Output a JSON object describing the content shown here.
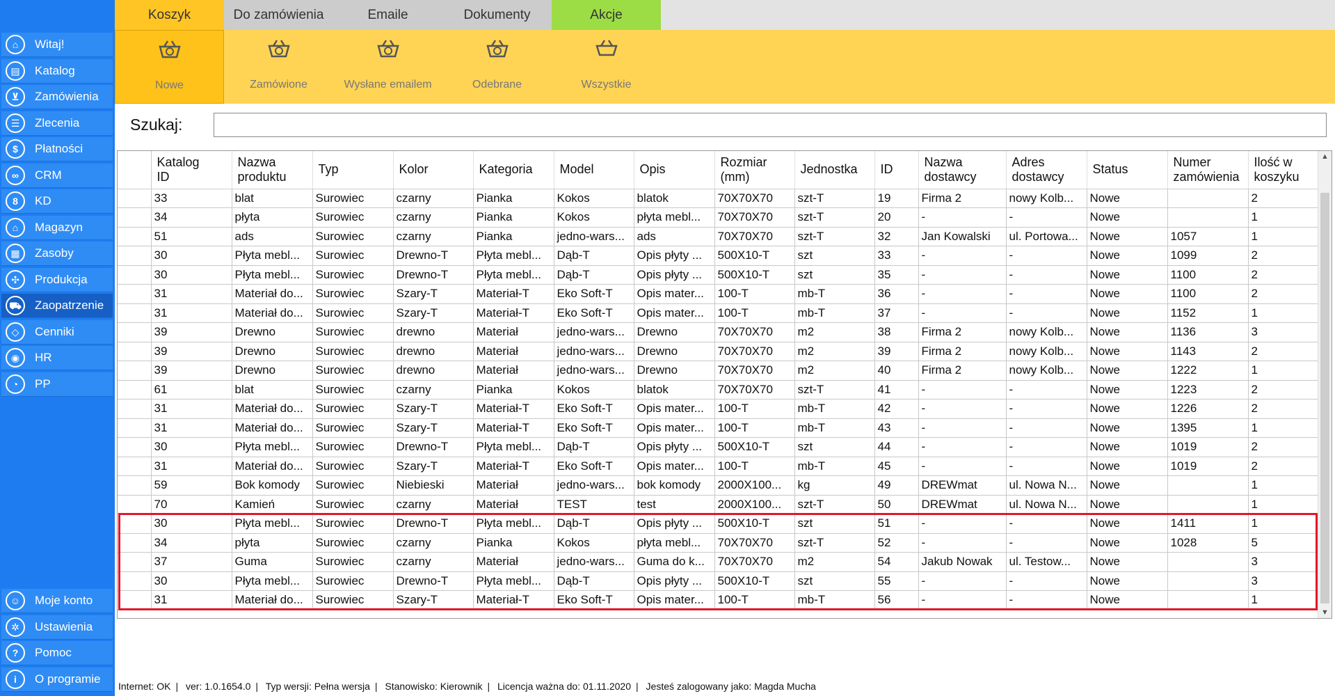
{
  "sidebar": {
    "top_items": [
      {
        "label": "Witaj!",
        "icon": "home-icon",
        "glyph": "⌂"
      },
      {
        "label": "Katalog",
        "icon": "catalog-icon",
        "glyph": "▤"
      },
      {
        "label": "Zamówienia",
        "icon": "cart-icon",
        "glyph": "⊻"
      },
      {
        "label": "Zlecenia",
        "icon": "list-icon",
        "glyph": "☰"
      },
      {
        "label": "Płatności",
        "icon": "dollar-icon",
        "glyph": "$"
      },
      {
        "label": "CRM",
        "icon": "crm-icon",
        "glyph": "∞"
      },
      {
        "label": "KD",
        "icon": "person-icon",
        "glyph": "8"
      },
      {
        "label": "Magazyn",
        "icon": "warehouse-icon",
        "glyph": "⌂"
      },
      {
        "label": "Zasoby",
        "icon": "resources-icon",
        "glyph": "▦"
      },
      {
        "label": "Produkcja",
        "icon": "production-icon",
        "glyph": "✣"
      },
      {
        "label": "Zaopatrzenie",
        "icon": "truck-icon",
        "glyph": "⛟"
      },
      {
        "label": "Cenniki",
        "icon": "tag-icon",
        "glyph": "◇"
      },
      {
        "label": "HR",
        "icon": "hr-icon",
        "glyph": "◉"
      },
      {
        "label": "PP",
        "icon": "chart-icon",
        "glyph": "◔"
      }
    ],
    "bottom_items": [
      {
        "label": "Moje konto",
        "icon": "account-icon",
        "glyph": "☺"
      },
      {
        "label": "Ustawienia",
        "icon": "settings-icon",
        "glyph": "✲"
      },
      {
        "label": "Pomoc",
        "icon": "help-icon",
        "glyph": "?"
      },
      {
        "label": "O programie",
        "icon": "info-icon",
        "glyph": "i"
      }
    ],
    "active_label": "Zaopatrzenie"
  },
  "tabs": [
    {
      "label": "Koszyk",
      "state": "active"
    },
    {
      "label": "Do zamówienia",
      "state": "normal"
    },
    {
      "label": "Emaile",
      "state": "normal"
    },
    {
      "label": "Dokumenty",
      "state": "normal"
    },
    {
      "label": "Akcje",
      "state": "green"
    }
  ],
  "ribbon": [
    {
      "label": "Nowe",
      "icon": "basket-new-icon",
      "active": true
    },
    {
      "label": "Zamówione",
      "icon": "basket-ordered-icon",
      "active": false
    },
    {
      "label": "Wysłane emailem",
      "icon": "basket-email-icon",
      "active": false
    },
    {
      "label": "Odebrane",
      "icon": "basket-received-icon",
      "active": false
    },
    {
      "label": "Wszystkie",
      "icon": "basket-all-icon",
      "active": false
    }
  ],
  "search": {
    "label": "Szukaj:",
    "value": "",
    "placeholder": ""
  },
  "table": {
    "columns": [
      {
        "key": "katalog_id",
        "label": "Katalog\nID"
      },
      {
        "key": "nazwa",
        "label": "Nazwa\nproduktu"
      },
      {
        "key": "typ",
        "label": "Typ"
      },
      {
        "key": "kolor",
        "label": "Kolor"
      },
      {
        "key": "kategoria",
        "label": "Kategoria"
      },
      {
        "key": "model",
        "label": "Model"
      },
      {
        "key": "opis",
        "label": "Opis"
      },
      {
        "key": "rozmiar",
        "label": "Rozmiar\n(mm)"
      },
      {
        "key": "jednostka",
        "label": "Jednostka"
      },
      {
        "key": "id",
        "label": "ID"
      },
      {
        "key": "dostawca",
        "label": "Nazwa\ndostawcy"
      },
      {
        "key": "adres",
        "label": "Adres\ndostawcy"
      },
      {
        "key": "status",
        "label": "Status"
      },
      {
        "key": "numer",
        "label": "Numer\nzamówienia"
      },
      {
        "key": "ilosc",
        "label": "Ilość w\nkoszyku"
      }
    ],
    "rows": [
      [
        "33",
        "blat",
        "Surowiec",
        "czarny",
        "Pianka",
        "Kokos",
        "blatok",
        "70X70X70",
        "szt-T",
        "19",
        "Firma 2",
        "nowy Kolb...",
        "Nowe",
        "",
        "2"
      ],
      [
        "34",
        "płyta",
        "Surowiec",
        "czarny",
        "Pianka",
        "Kokos",
        "płyta mebl...",
        "70X70X70",
        "szt-T",
        "20",
        "-",
        "-",
        "Nowe",
        "",
        "1"
      ],
      [
        "51",
        "ads",
        "Surowiec",
        "czarny",
        "Pianka",
        "jedno-wars...",
        "ads",
        "70X70X70",
        "szt-T",
        "32",
        "Jan Kowalski",
        "ul. Portowa...",
        "Nowe",
        "1057",
        "1"
      ],
      [
        "30",
        "Płyta mebl...",
        "Surowiec",
        "Drewno-T",
        "Płyta mebl...",
        "Dąb-T",
        "Opis płyty ...",
        "500X10-T",
        "szt",
        "33",
        "-",
        "-",
        "Nowe",
        "1099",
        "2"
      ],
      [
        "30",
        "Płyta mebl...",
        "Surowiec",
        "Drewno-T",
        "Płyta mebl...",
        "Dąb-T",
        "Opis płyty ...",
        "500X10-T",
        "szt",
        "35",
        "-",
        "-",
        "Nowe",
        "1100",
        "2"
      ],
      [
        "31",
        "Materiał do...",
        "Surowiec",
        "Szary-T",
        "Materiał-T",
        "Eko Soft-T",
        "Opis mater...",
        "100-T",
        "mb-T",
        "36",
        "-",
        "-",
        "Nowe",
        "1100",
        "2"
      ],
      [
        "31",
        "Materiał do...",
        "Surowiec",
        "Szary-T",
        "Materiał-T",
        "Eko Soft-T",
        "Opis mater...",
        "100-T",
        "mb-T",
        "37",
        "-",
        "-",
        "Nowe",
        "1152",
        "1"
      ],
      [
        "39",
        "Drewno",
        "Surowiec",
        "drewno",
        "Materiał",
        "jedno-wars...",
        "Drewno",
        "70X70X70",
        "m2",
        "38",
        "Firma 2",
        "nowy Kolb...",
        "Nowe",
        "1136",
        "3"
      ],
      [
        "39",
        "Drewno",
        "Surowiec",
        "drewno",
        "Materiał",
        "jedno-wars...",
        "Drewno",
        "70X70X70",
        "m2",
        "39",
        "Firma 2",
        "nowy Kolb...",
        "Nowe",
        "1143",
        "2"
      ],
      [
        "39",
        "Drewno",
        "Surowiec",
        "drewno",
        "Materiał",
        "jedno-wars...",
        "Drewno",
        "70X70X70",
        "m2",
        "40",
        "Firma 2",
        "nowy Kolb...",
        "Nowe",
        "1222",
        "1"
      ],
      [
        "61",
        "blat",
        "Surowiec",
        "czarny",
        "Pianka",
        "Kokos",
        "blatok",
        "70X70X70",
        "szt-T",
        "41",
        "-",
        "-",
        "Nowe",
        "1223",
        "2"
      ],
      [
        "31",
        "Materiał do...",
        "Surowiec",
        "Szary-T",
        "Materiał-T",
        "Eko Soft-T",
        "Opis mater...",
        "100-T",
        "mb-T",
        "42",
        "-",
        "-",
        "Nowe",
        "1226",
        "2"
      ],
      [
        "31",
        "Materiał do...",
        "Surowiec",
        "Szary-T",
        "Materiał-T",
        "Eko Soft-T",
        "Opis mater...",
        "100-T",
        "mb-T",
        "43",
        "-",
        "-",
        "Nowe",
        "1395",
        "1"
      ],
      [
        "30",
        "Płyta mebl...",
        "Surowiec",
        "Drewno-T",
        "Płyta mebl...",
        "Dąb-T",
        "Opis płyty ...",
        "500X10-T",
        "szt",
        "44",
        "-",
        "-",
        "Nowe",
        "1019",
        "2"
      ],
      [
        "31",
        "Materiał do...",
        "Surowiec",
        "Szary-T",
        "Materiał-T",
        "Eko Soft-T",
        "Opis mater...",
        "100-T",
        "mb-T",
        "45",
        "-",
        "-",
        "Nowe",
        "1019",
        "2"
      ],
      [
        "59",
        "Bok komody",
        "Surowiec",
        "Niebieski",
        "Materiał",
        "jedno-wars...",
        "bok komody",
        "2000X100...",
        "kg",
        "49",
        "DREWmat",
        "ul. Nowa N...",
        "Nowe",
        "",
        "1"
      ],
      [
        "70",
        "Kamień",
        "Surowiec",
        "czarny",
        "Materiał",
        "TEST",
        "test",
        "2000X100...",
        "szt-T",
        "50",
        "DREWmat",
        "ul. Nowa N...",
        "Nowe",
        "",
        "1"
      ],
      [
        "30",
        "Płyta mebl...",
        "Surowiec",
        "Drewno-T",
        "Płyta mebl...",
        "Dąb-T",
        "Opis płyty ...",
        "500X10-T",
        "szt",
        "51",
        "-",
        "-",
        "Nowe",
        "1411",
        "1"
      ],
      [
        "34",
        "płyta",
        "Surowiec",
        "czarny",
        "Pianka",
        "Kokos",
        "płyta mebl...",
        "70X70X70",
        "szt-T",
        "52",
        "-",
        "-",
        "Nowe",
        "1028",
        "5"
      ],
      [
        "37",
        "Guma",
        "Surowiec",
        "czarny",
        "Materiał",
        "jedno-wars...",
        "Guma do k...",
        "70X70X70",
        "m2",
        "54",
        "Jakub Nowak",
        "ul. Testow...",
        "Nowe",
        "",
        "3"
      ],
      [
        "30",
        "Płyta mebl...",
        "Surowiec",
        "Drewno-T",
        "Płyta mebl...",
        "Dąb-T",
        "Opis płyty ...",
        "500X10-T",
        "szt",
        "55",
        "-",
        "-",
        "Nowe",
        "",
        "3"
      ],
      [
        "31",
        "Materiał do...",
        "Surowiec",
        "Szary-T",
        "Materiał-T",
        "Eko Soft-T",
        "Opis mater...",
        "100-T",
        "mb-T",
        "56",
        "-",
        "-",
        "Nowe",
        "",
        "1"
      ]
    ],
    "highlighted_row_ids": [
      "51",
      "52",
      "54",
      "55",
      "56"
    ]
  },
  "statusbar": {
    "internet": "Internet: OK",
    "version": "ver: 1.0.1654.0",
    "type": "Typ wersji: Pełna wersja",
    "station": "Stanowisko: Kierownik",
    "license": "Licencja ważna do: 01.11.2020",
    "user": "Jesteś zalogowany jako: Magda Mucha"
  },
  "colors": {
    "sidebar_bg": "#1e7cf0",
    "tab_active": "#ffc525",
    "tab_green": "#9cdc44",
    "ribbon_bg": "#ffd454",
    "highlight_border": "#e3172b"
  }
}
